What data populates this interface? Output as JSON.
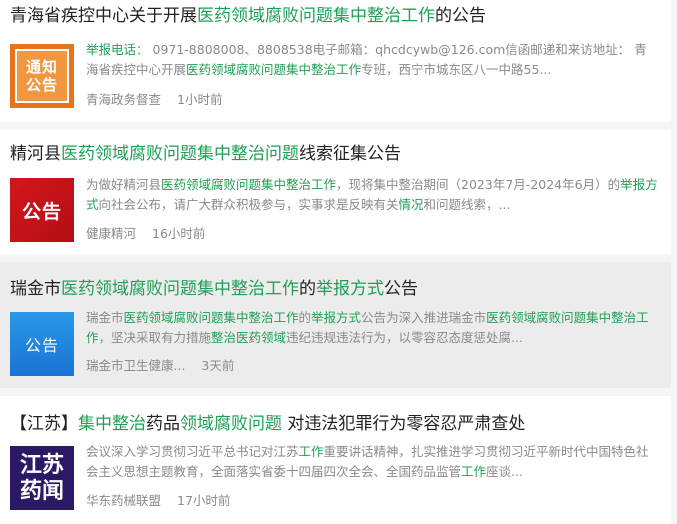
{
  "results": [
    {
      "title": [
        {
          "t": "青海省疾控中心关于开展",
          "g": false
        },
        {
          "t": "医药领域腐败问题集中整治工作",
          "g": true
        },
        {
          "t": "的公告",
          "g": false
        }
      ],
      "thumb_lines": [
        "通知",
        "公告"
      ],
      "snippet": [
        {
          "t": "举报电话",
          "g": true
        },
        {
          "t": "：  0971-8808008、8808538电子邮箱：qhcdcywb@126.com信函邮递和来访地址：  青海省疾控中心开展",
          "g": false
        },
        {
          "t": "医药领域腐败问题集中整治工作",
          "g": true
        },
        {
          "t": "专班，西宁市城东区八一中路55...",
          "g": false
        }
      ],
      "source": "青海政务督查",
      "time": "1小时前"
    },
    {
      "title": [
        {
          "t": "精河县",
          "g": false
        },
        {
          "t": "医药领域腐败问题集中整治问题",
          "g": true
        },
        {
          "t": "线索征集公告",
          "g": false
        }
      ],
      "thumb_lines": [
        "公告"
      ],
      "snippet": [
        {
          "t": "为做好精河县",
          "g": false
        },
        {
          "t": "医药领域腐败问题集中整治工作",
          "g": true
        },
        {
          "t": "，现将集中整治期间（2023年7月-2024年6月）的",
          "g": false
        },
        {
          "t": "举报方式",
          "g": true
        },
        {
          "t": "向社会公布，请广大群众积极参与，实事求是反映有关",
          "g": false
        },
        {
          "t": "情况",
          "g": true
        },
        {
          "t": "和问题线索，...",
          "g": false
        }
      ],
      "source": "健康精河",
      "time": "16小时前"
    },
    {
      "title": [
        {
          "t": "瑞金市",
          "g": false
        },
        {
          "t": "医药领域腐败问题集中整治工作",
          "g": true
        },
        {
          "t": "的",
          "g": false
        },
        {
          "t": "举报方式",
          "g": true
        },
        {
          "t": "公告",
          "g": false
        }
      ],
      "thumb_lines": [
        "公告"
      ],
      "snippet": [
        {
          "t": "瑞金市",
          "g": false
        },
        {
          "t": "医药领域腐败问题集中整治工作",
          "g": true
        },
        {
          "t": "的",
          "g": false
        },
        {
          "t": "举报方式",
          "g": true
        },
        {
          "t": "公告为深入推进瑞金市",
          "g": false
        },
        {
          "t": "医药领域腐败问题集中整治工作",
          "g": true
        },
        {
          "t": "，坚决采取有力措施",
          "g": false
        },
        {
          "t": "整治医药领域",
          "g": true
        },
        {
          "t": "违纪违规违法行为，以零容忍态度惩处腐...",
          "g": false
        }
      ],
      "source": "瑞金市卫生健康...",
      "time": "3天前"
    },
    {
      "title": [
        {
          "t": "【江苏】",
          "g": false
        },
        {
          "t": "集中整治",
          "g": true
        },
        {
          "t": "药品",
          "g": false
        },
        {
          "t": "领域腐败问题",
          "g": true
        },
        {
          "t": " 对违法犯罪行为零容忍严肃查处",
          "g": false
        }
      ],
      "thumb_lines": [
        "江苏",
        "药闻"
      ],
      "snippet": [
        {
          "t": "会议深入学习贯彻习近平总书记对江苏",
          "g": false
        },
        {
          "t": "工作",
          "g": true
        },
        {
          "t": "重要讲话精神，扎实推进学习贯彻习近平新时代中国特色社会主义思想主题教育，全面落实省委十四届四次全会、全国药品监管",
          "g": false
        },
        {
          "t": "工作",
          "g": true
        },
        {
          "t": "座谈...",
          "g": false
        }
      ],
      "source": "华东药械联盟",
      "time": "17小时前"
    }
  ]
}
